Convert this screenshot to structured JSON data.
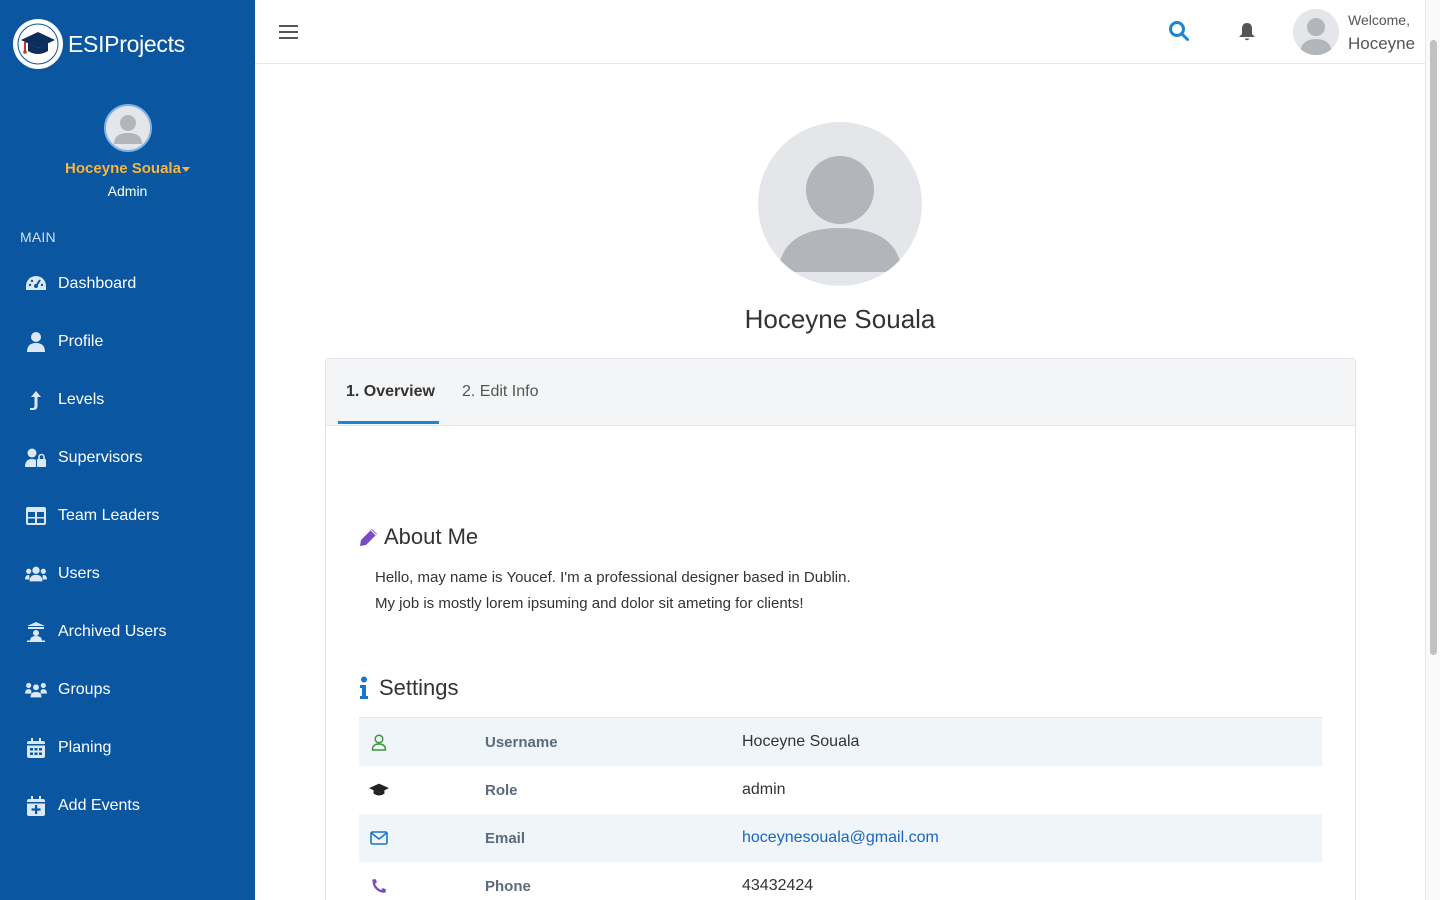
{
  "brand": {
    "name": "ESIProjects"
  },
  "sidebar": {
    "user_name": "Hoceyne Souala",
    "user_role": "Admin",
    "section_label": "MAIN",
    "items": [
      {
        "label": "Dashboard",
        "icon": "dashboard-icon"
      },
      {
        "label": "Profile",
        "icon": "user-icon"
      },
      {
        "label": "Levels",
        "icon": "level-up-icon"
      },
      {
        "label": "Supervisors",
        "icon": "user-lock-icon"
      },
      {
        "label": "Team Leaders",
        "icon": "table-icon"
      },
      {
        "label": "Users",
        "icon": "users-icon"
      },
      {
        "label": "Archived Users",
        "icon": "archive-user-icon"
      },
      {
        "label": "Groups",
        "icon": "groups-icon"
      },
      {
        "label": "Planing",
        "icon": "calendar-icon"
      },
      {
        "label": "Add Events",
        "icon": "calendar-plus-icon"
      }
    ]
  },
  "topbar": {
    "welcome": "Welcome,",
    "welcome_name": "Hoceyne"
  },
  "profile": {
    "name": "Hoceyne Souala",
    "tabs": [
      {
        "label": "1. Overview",
        "active": true
      },
      {
        "label": "2. Edit Info",
        "active": false
      }
    ],
    "about": {
      "title": "About Me",
      "line1": "Hello, may name is Youcef. I'm a professional designer based in Dublin.",
      "line2": "My job is mostly lorem ipsuming and dolor sit ameting for clients!"
    },
    "settings": {
      "title": "Settings",
      "rows": [
        {
          "key": "Username",
          "value": "Hoceyne Souala",
          "icon": "user-outline-icon"
        },
        {
          "key": "Role",
          "value": "admin",
          "icon": "graduation-cap-icon"
        },
        {
          "key": "Email",
          "value": "hoceynesouala@gmail.com",
          "icon": "envelope-icon"
        },
        {
          "key": "Phone",
          "value": "43432424",
          "icon": "phone-icon"
        }
      ]
    }
  },
  "colors": {
    "sidebar_bg": "#0a56a1",
    "accent": "#1a86d6",
    "user_name": "#f5b642",
    "link": "#1766c0"
  }
}
